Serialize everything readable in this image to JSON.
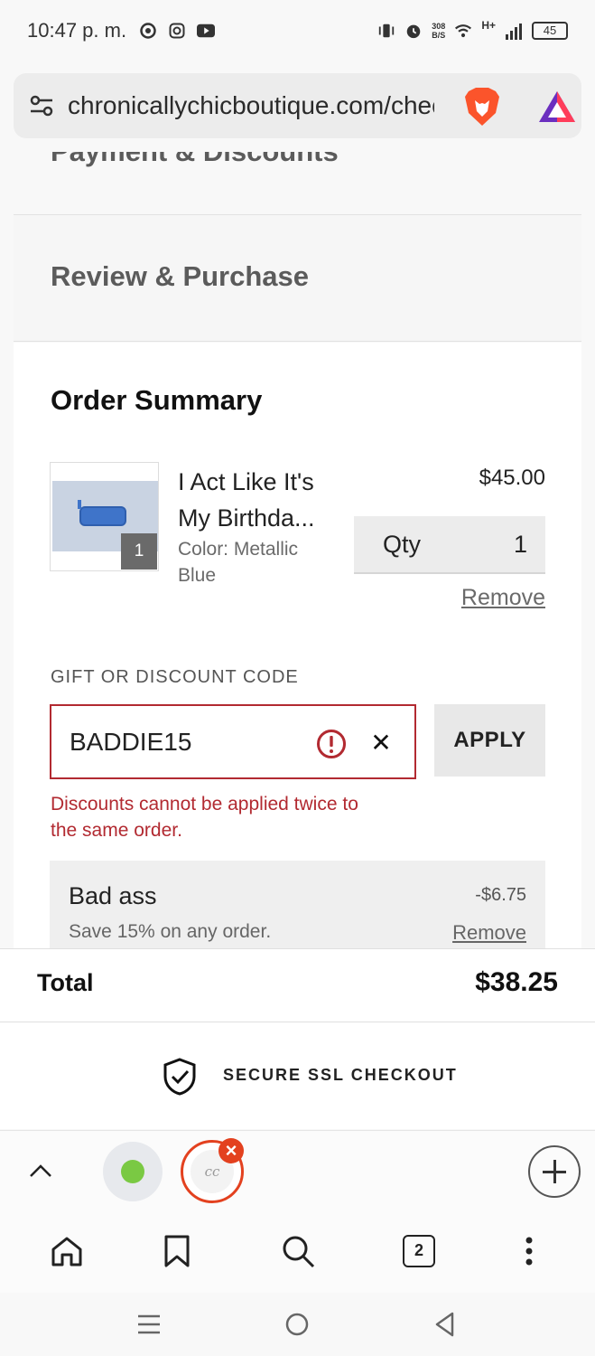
{
  "status_bar": {
    "time": "10:47 p. m.",
    "net_speed_top": "308",
    "net_speed_bottom": "B/S",
    "network": "H+",
    "battery": "45"
  },
  "browser": {
    "url": "chronicallychicboutique.com/checkout",
    "tab_count": "2"
  },
  "checkout": {
    "step_payment": "Payment & Discounts",
    "step_review": "Review & Purchase",
    "summary_title": "Order Summary",
    "item": {
      "name_line1": "I Act Like It's",
      "name_line2": "My Birthda...",
      "variant_line1": "Color: Metallic",
      "variant_line2": "Blue",
      "price": "$45.00",
      "qty_label": "Qty",
      "qty_value": "1",
      "badge_count": "1",
      "remove_label": "Remove"
    },
    "discount": {
      "label": "GIFT OR DISCOUNT CODE",
      "value": "BADDIE15",
      "apply_label": "APPLY",
      "error_line1": "Discounts cannot be applied twice to",
      "error_line2": "the same order."
    },
    "applied_discount": {
      "name": "Bad ass",
      "amount": "-$6.75",
      "description": "Save 15% on any order.",
      "remove_label": "Remove"
    },
    "total_label": "Total",
    "total_value": "$38.25",
    "secure_label": "SECURE SSL CHECKOUT"
  },
  "tab_strip": {
    "active_tab_monogram": "cc"
  },
  "colors": {
    "error_red": "#b22a31",
    "brave_orange": "#fb542b",
    "tab_close_red": "#e3411f"
  }
}
